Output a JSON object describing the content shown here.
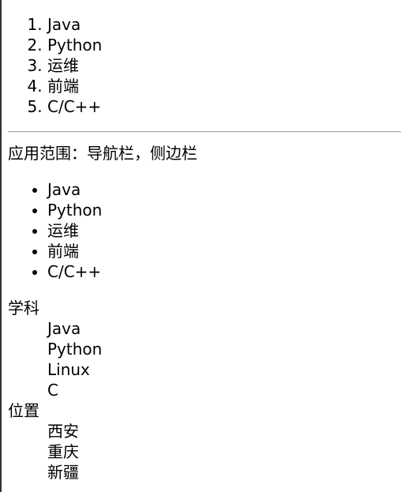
{
  "ordered_list": {
    "items": [
      "Java",
      "Python",
      "运维",
      "前端",
      "C/C++"
    ]
  },
  "usage_text": "应用范围：导航栏，侧边栏",
  "unordered_list": {
    "items": [
      "Java",
      "Python",
      "运维",
      "前端",
      "C/C++"
    ]
  },
  "definition_list": {
    "groups": [
      {
        "term": "学科",
        "definitions": [
          "Java",
          "Python",
          "Linux",
          "C"
        ]
      },
      {
        "term": "位置",
        "definitions": [
          "西安",
          "重庆",
          "新疆"
        ]
      }
    ]
  }
}
